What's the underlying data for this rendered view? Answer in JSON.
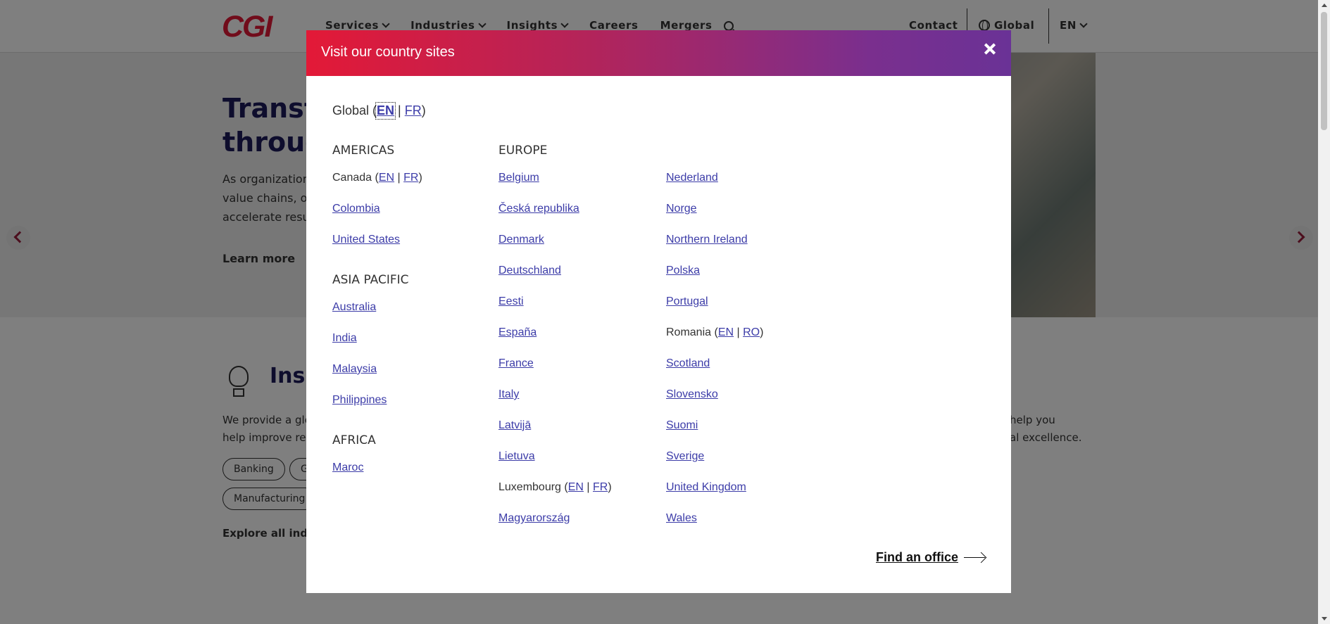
{
  "header": {
    "logo": "CGI",
    "nav": [
      "Services",
      "Industries",
      "Insights",
      "Careers",
      "Mergers"
    ],
    "contact": "Contact",
    "global": "Global",
    "lang": "EN"
  },
  "hero": {
    "title_line1": "Transfo",
    "title_line2": "through",
    "text_line1": "As organizations",
    "text_line2": "value chains, ou",
    "text_line3": "accelerate resul",
    "link": "Learn more"
  },
  "insights": {
    "title": "Insig",
    "text_line1": "We provide a glob",
    "text_line2": "help improve retu",
    "text_r_line1": "help you",
    "text_r_line2": "al excellence.",
    "chips": [
      "Banking",
      "G",
      "Manufacturing"
    ],
    "explore": "Explore all indust"
  },
  "modal": {
    "title": "Visit our country sites",
    "global": {
      "label": "Global (",
      "en": "EN",
      "fr": "FR",
      "close_paren": ")"
    },
    "americas": {
      "heading": "AMERICAS",
      "canada": {
        "label": "Canada (",
        "en": "EN",
        "fr": "FR",
        "close": ")"
      },
      "items": [
        "Colombia",
        "United States"
      ]
    },
    "asia_pacific": {
      "heading": "ASIA PACIFIC",
      "items": [
        "Australia",
        "India",
        "Malaysia",
        "Philippines"
      ]
    },
    "africa": {
      "heading": "AFRICA",
      "items": [
        "Maroc"
      ]
    },
    "europe": {
      "heading": "EUROPE",
      "col1": [
        "Belgium",
        "Česká republika",
        "Denmark",
        "Deutschland",
        "Eesti",
        "España",
        "France",
        "Italy",
        "Latvijā",
        "Lietuva"
      ],
      "luxembourg": {
        "label": "Luxembourg (",
        "en": "EN",
        "fr": "FR",
        "close": ")"
      },
      "col1_last": "Magyarország",
      "col2_a": [
        "Nederland",
        "Norge",
        "Northern Ireland",
        "Polska",
        "Portugal"
      ],
      "romania": {
        "label": "Romania (",
        "en": "EN",
        "ro": "RO",
        "close": ")"
      },
      "col2_b": [
        "Scotland",
        "Slovensko",
        "Suomi",
        "Sverige",
        "United Kingdom",
        "Wales"
      ]
    },
    "find_office": "Find an office"
  },
  "colors": {
    "brand_red": "#e31937",
    "brand_purple": "#6a3296",
    "link": "#3c3ca8",
    "navy": "#1c1a5a"
  }
}
